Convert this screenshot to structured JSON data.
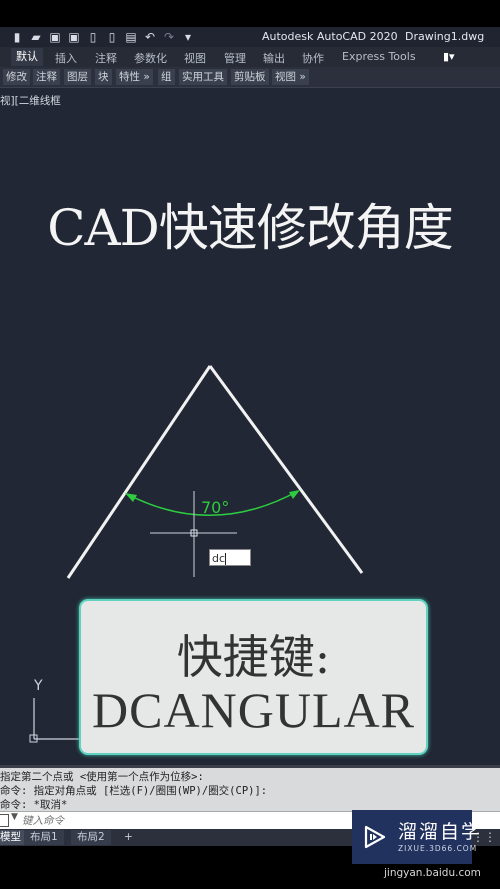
{
  "app": {
    "title": "Autodesk AutoCAD 2020",
    "document": "Drawing1.dwg"
  },
  "quick_access": [
    {
      "name": "new-icon",
      "glyph": "▬"
    },
    {
      "name": "open-icon",
      "glyph": "▰"
    },
    {
      "name": "save-icon",
      "glyph": "▣"
    },
    {
      "name": "save-as-icon",
      "glyph": "▣"
    },
    {
      "name": "web-mobile-open-icon",
      "glyph": "▯"
    },
    {
      "name": "web-mobile-save-icon",
      "glyph": "▯"
    },
    {
      "name": "plot-icon",
      "glyph": "▤"
    },
    {
      "name": "undo-icon",
      "glyph": "↶"
    },
    {
      "name": "redo-icon",
      "glyph": "↷"
    },
    {
      "name": "customize-icon",
      "glyph": "▾"
    }
  ],
  "ribbon_tabs": [
    "默认",
    "插入",
    "注释",
    "参数化",
    "视图",
    "管理",
    "输出",
    "协作",
    "Express Tools"
  ],
  "ribbon_active_tab": "默认",
  "panels": [
    "修改",
    "注释",
    "图层",
    "块",
    "特性 »",
    "组",
    "实用工具",
    "剪贴板",
    "视图 »"
  ],
  "viewport_label": "视][二维线框",
  "canvas": {
    "headline": "CAD快速修改角度",
    "dimension_text": "70°",
    "dynamic_input_value": "dc",
    "ucs_label": "Y"
  },
  "shortcut_card": {
    "title": "快捷键:",
    "command": "DCANGULAR"
  },
  "colors": {
    "canvas_bg": "#212734",
    "dimension_green": "#2ecc40",
    "card_border": "#5fd3c0"
  },
  "command_history": [
    "指定第二个点或 <使用第一个点作为位移>:",
    "命令: 指定对角点或 [栏选(F)/圈围(WP)/圈交(CP)]:",
    "命令: *取消*"
  ],
  "command_input": {
    "placeholder": "键入命令"
  },
  "layout_tabs": [
    "模型",
    "布局1",
    "布局2",
    "+"
  ],
  "layout_active_tab": "模型",
  "watermark": {
    "name": "溜溜自学",
    "url": "ZIXUE.3D66.COM"
  },
  "credit": "jingyan.baidu.com"
}
